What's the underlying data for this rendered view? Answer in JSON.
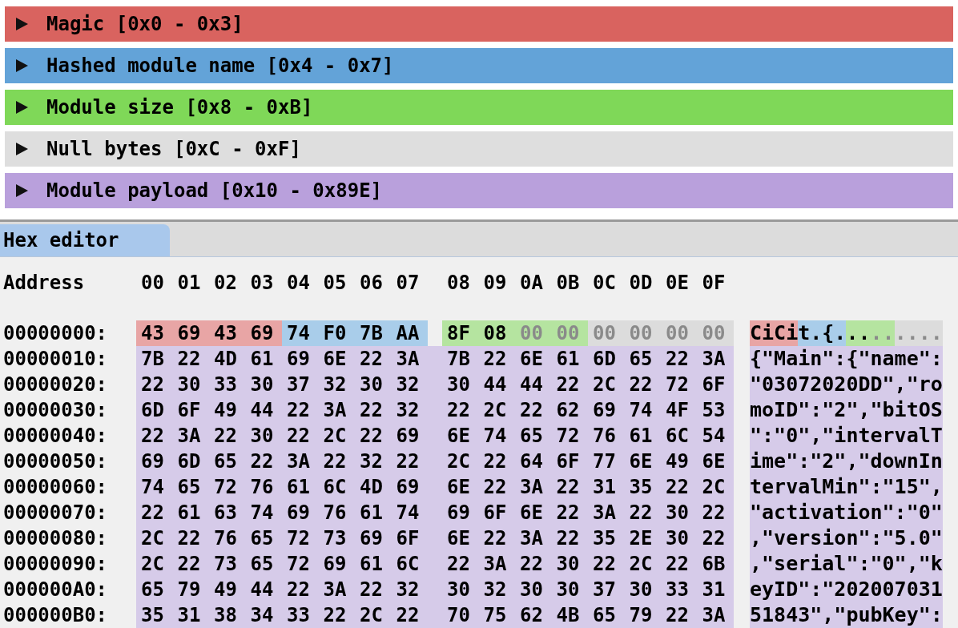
{
  "sections": [
    {
      "label": "Magic [0x0 - 0x3]",
      "color": "#d9635f",
      "expanded": false
    },
    {
      "label": "Hashed module name [0x4 - 0x7]",
      "color": "#63a3d8",
      "expanded": false
    },
    {
      "label": "Module size [0x8 - 0xB]",
      "color": "#7fd858",
      "expanded": false
    },
    {
      "label": "Null bytes [0xC - 0xF]",
      "color": "#dedede",
      "expanded": false
    },
    {
      "label": "Module payload [0x10 - 0x89E]",
      "color": "#b9a0dc",
      "expanded": false
    }
  ],
  "hex_editor": {
    "tab": {
      "label": "Hex editor",
      "selected": true
    },
    "address_header": "Address",
    "columns": [
      "00",
      "01",
      "02",
      "03",
      "04",
      "05",
      "06",
      "07",
      "08",
      "09",
      "0A",
      "0B",
      "0C",
      "0D",
      "0E",
      "0F"
    ],
    "rows": [
      {
        "address": "00000000:",
        "segments": [
          {
            "color": "#e8a5a5",
            "dim": false,
            "bytes": [
              "43",
              "69",
              "43",
              "69"
            ],
            "ascii": "CiCi"
          },
          {
            "color": "#a9cdea",
            "dim": false,
            "bytes": [
              "74",
              "F0",
              "7B",
              "AA"
            ],
            "ascii": "t.{."
          },
          {
            "color": "#b5e4a0",
            "dim": false,
            "bytes": [
              "8F",
              "08"
            ],
            "ascii": ".."
          },
          {
            "color": "#b5e4a0",
            "dim": true,
            "bytes": [
              "00",
              "00"
            ],
            "ascii": ".."
          },
          {
            "color": "#dcdcdc",
            "dim": true,
            "bytes": [
              "00",
              "00",
              "00",
              "00"
            ],
            "ascii": "...."
          }
        ]
      },
      {
        "address": "00000010:",
        "segments": [
          {
            "color": "#d6cbe9",
            "dim": false,
            "bytes": [
              "7B",
              "22",
              "4D",
              "61",
              "69",
              "6E",
              "22",
              "3A",
              "7B",
              "22",
              "6E",
              "61",
              "6D",
              "65",
              "22",
              "3A"
            ],
            "ascii": "{\"Main\":{\"name\":"
          }
        ]
      },
      {
        "address": "00000020:",
        "segments": [
          {
            "color": "#d6cbe9",
            "dim": false,
            "bytes": [
              "22",
              "30",
              "33",
              "30",
              "37",
              "32",
              "30",
              "32",
              "30",
              "44",
              "44",
              "22",
              "2C",
              "22",
              "72",
              "6F"
            ],
            "ascii": "\"03072020DD\",\"ro"
          }
        ]
      },
      {
        "address": "00000030:",
        "segments": [
          {
            "color": "#d6cbe9",
            "dim": false,
            "bytes": [
              "6D",
              "6F",
              "49",
              "44",
              "22",
              "3A",
              "22",
              "32",
              "22",
              "2C",
              "22",
              "62",
              "69",
              "74",
              "4F",
              "53"
            ],
            "ascii": "moID\":\"2\",\"bitOS"
          }
        ]
      },
      {
        "address": "00000040:",
        "segments": [
          {
            "color": "#d6cbe9",
            "dim": false,
            "bytes": [
              "22",
              "3A",
              "22",
              "30",
              "22",
              "2C",
              "22",
              "69",
              "6E",
              "74",
              "65",
              "72",
              "76",
              "61",
              "6C",
              "54"
            ],
            "ascii": "\":\"0\",\"intervalT"
          }
        ]
      },
      {
        "address": "00000050:",
        "segments": [
          {
            "color": "#d6cbe9",
            "dim": false,
            "bytes": [
              "69",
              "6D",
              "65",
              "22",
              "3A",
              "22",
              "32",
              "22",
              "2C",
              "22",
              "64",
              "6F",
              "77",
              "6E",
              "49",
              "6E"
            ],
            "ascii": "ime\":\"2\",\"downIn"
          }
        ]
      },
      {
        "address": "00000060:",
        "segments": [
          {
            "color": "#d6cbe9",
            "dim": false,
            "bytes": [
              "74",
              "65",
              "72",
              "76",
              "61",
              "6C",
              "4D",
              "69",
              "6E",
              "22",
              "3A",
              "22",
              "31",
              "35",
              "22",
              "2C"
            ],
            "ascii": "tervalMin\":\"15\","
          }
        ]
      },
      {
        "address": "00000070:",
        "segments": [
          {
            "color": "#d6cbe9",
            "dim": false,
            "bytes": [
              "22",
              "61",
              "63",
              "74",
              "69",
              "76",
              "61",
              "74",
              "69",
              "6F",
              "6E",
              "22",
              "3A",
              "22",
              "30",
              "22"
            ],
            "ascii": "\"activation\":\"0\""
          }
        ]
      },
      {
        "address": "00000080:",
        "segments": [
          {
            "color": "#d6cbe9",
            "dim": false,
            "bytes": [
              "2C",
              "22",
              "76",
              "65",
              "72",
              "73",
              "69",
              "6F",
              "6E",
              "22",
              "3A",
              "22",
              "35",
              "2E",
              "30",
              "22"
            ],
            "ascii": ",\"version\":\"5.0\""
          }
        ]
      },
      {
        "address": "00000090:",
        "segments": [
          {
            "color": "#d6cbe9",
            "dim": false,
            "bytes": [
              "2C",
              "22",
              "73",
              "65",
              "72",
              "69",
              "61",
              "6C",
              "22",
              "3A",
              "22",
              "30",
              "22",
              "2C",
              "22",
              "6B"
            ],
            "ascii": ",\"serial\":\"0\",\"k"
          }
        ]
      },
      {
        "address": "000000A0:",
        "segments": [
          {
            "color": "#d6cbe9",
            "dim": false,
            "bytes": [
              "65",
              "79",
              "49",
              "44",
              "22",
              "3A",
              "22",
              "32",
              "30",
              "32",
              "30",
              "30",
              "37",
              "30",
              "33",
              "31"
            ],
            "ascii": "eyID\":\"202007031"
          }
        ]
      },
      {
        "address": "000000B0:",
        "segments": [
          {
            "color": "#d6cbe9",
            "dim": false,
            "bytes": [
              "35",
              "31",
              "38",
              "34",
              "33",
              "22",
              "2C",
              "22",
              "70",
              "75",
              "62",
              "4B",
              "65",
              "79",
              "22",
              "3A"
            ],
            "ascii": "51843\",\"pubKey\":"
          }
        ]
      }
    ]
  }
}
